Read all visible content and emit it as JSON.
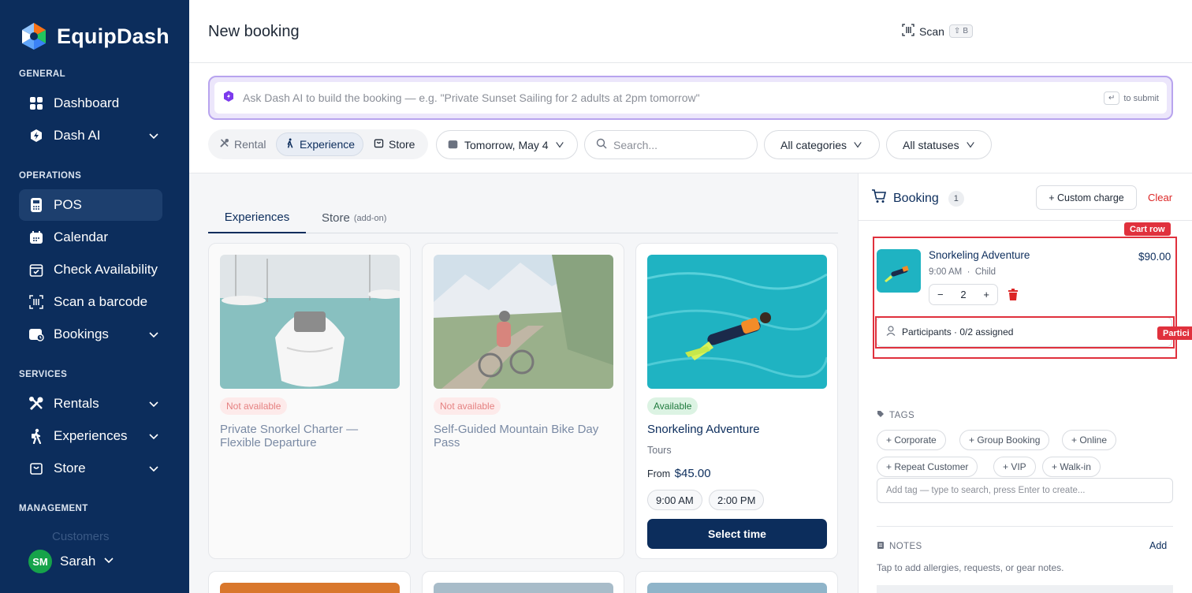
{
  "app": {
    "name": "EquipDash"
  },
  "sidebar": {
    "sections": {
      "general": "GENERAL",
      "operations": "OPERATIONS",
      "services": "SERVICES",
      "management": "MANAGEMENT"
    },
    "items": [
      {
        "label": "Dashboard"
      },
      {
        "label": "Dash AI"
      },
      {
        "label": "POS"
      },
      {
        "label": "Calendar"
      },
      {
        "label": "Check Availability"
      },
      {
        "label": "Scan a barcode"
      },
      {
        "label": "Bookings"
      },
      {
        "label": "Rentals"
      },
      {
        "label": "Experiences"
      },
      {
        "label": "Store"
      },
      {
        "label": "Customers"
      }
    ],
    "user": {
      "initials": "SM",
      "name": "Sarah"
    }
  },
  "header": {
    "title": "New booking",
    "scan_label": "Scan",
    "scan_shortcut": "B"
  },
  "ai": {
    "placeholder": "Ask Dash AI to build the booking — e.g. \"Private Sunset Sailing for 2 adults at 2pm tomorrow\"",
    "submit_hint": "to submit"
  },
  "filters": {
    "modes": [
      "Rental",
      "Experience",
      "Store"
    ],
    "date": "Tomorrow, May 4",
    "search_placeholder": "Search...",
    "category": "All categories",
    "status": "All statuses"
  },
  "tabs": {
    "experiences": "Experiences",
    "store": "Store",
    "store_note": "(add-on)"
  },
  "products": [
    {
      "status": "Not available",
      "title": "Private Snorkel Charter — Flexible Departure"
    },
    {
      "status": "Not available",
      "title": "Self-Guided Mountain Bike Day Pass"
    },
    {
      "status": "Available",
      "title": "Snorkeling Adventure",
      "category": "Tours",
      "from_label": "From",
      "price": "$45.00",
      "times": [
        "9:00 AM",
        "2:00 PM"
      ],
      "button": "Select time"
    }
  ],
  "booking": {
    "title": "Booking",
    "count": "1",
    "custom_charge": "+ Custom charge",
    "clear": "Clear",
    "cart_row_label": "Cart row",
    "participants_tag": "Partici",
    "item": {
      "name": "Snorkeling Adventure",
      "time": "9:00 AM",
      "type": "Child",
      "price": "$90.00",
      "qty": "2"
    },
    "participants": "Participants · 0/2 assigned",
    "tags_label": "TAGS",
    "tags": [
      "+ Corporate",
      "+ Group Booking",
      "+ Online",
      "+ Repeat Customer",
      "+ VIP",
      "+ Walk-in"
    ],
    "tag_placeholder": "Add tag — type to search, press Enter to create...",
    "notes_label": "NOTES",
    "notes_add": "Add",
    "notes_hint": "Tap to add allergies, requests, or gear notes."
  },
  "colors": {
    "brand": "#0c2d5c",
    "accent_purple": "#b8a4ee",
    "danger": "#dc2626",
    "success": "#16a34a"
  }
}
